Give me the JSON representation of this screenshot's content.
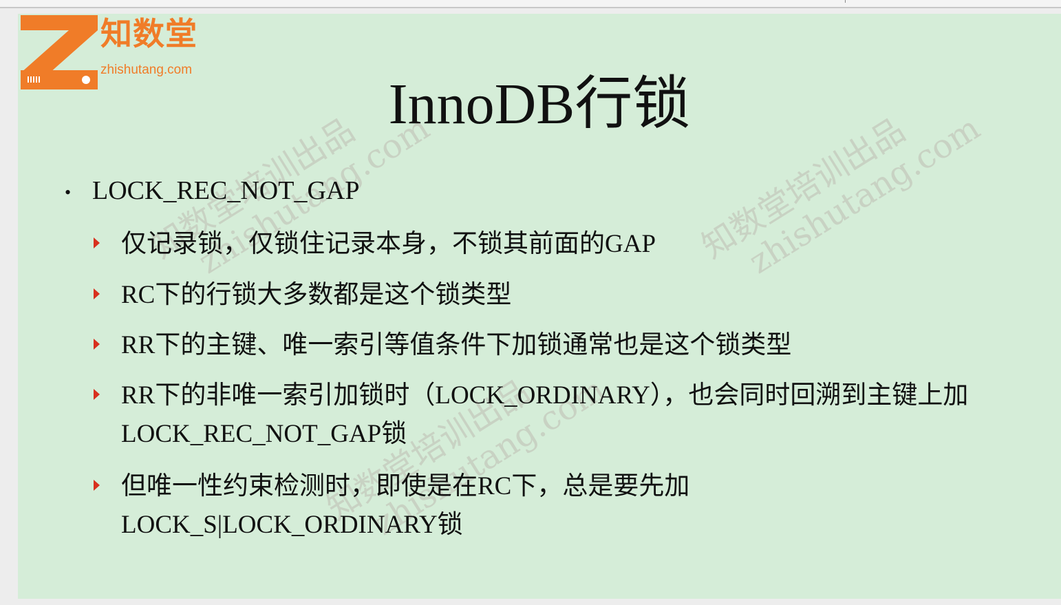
{
  "logo": {
    "cn": "知数堂",
    "url": "zhishutang.com",
    "mark_letter": "Z"
  },
  "watermarks": [
    {
      "line1": "知数堂培训出品",
      "line2": "zhishutang.com"
    },
    {
      "line1": "知数堂培训出品",
      "line2": "zhishutang.com"
    },
    {
      "line1": "知数堂培训出品",
      "line2": "zhishutang.com"
    }
  ],
  "title": "InnoDB行锁",
  "bullet": "LOCK_REC_NOT_GAP",
  "subitems": [
    "仅记录锁，仅锁住记录本身，不锁其前面的GAP",
    "RC下的行锁大多数都是这个锁类型",
    "RR下的主键、唯一索引等值条件下加锁通常也是这个锁类型",
    "RR下的非唯一索引加锁时（LOCK_ORDINARY），也会同时回溯到主键上加LOCK_REC_NOT_GAP锁",
    "但唯一性约束检测时，即使是在RC下，总是要先加 LOCK_S|LOCK_ORDINARY锁"
  ],
  "colors": {
    "slide_bg": "#d5edd8",
    "accent_orange": "#f07c28",
    "arrow_red": "#d8301e",
    "text": "#111111"
  }
}
